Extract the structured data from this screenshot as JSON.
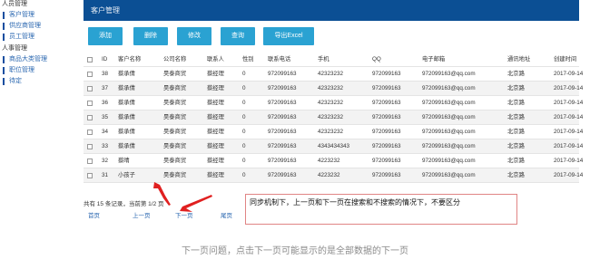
{
  "sidebar": {
    "groups": [
      {
        "label": "人员管理",
        "items": [
          "客户管理",
          "供应商管理",
          "员工管理"
        ]
      },
      {
        "label": "人事管理",
        "items": [
          "商品大类管理",
          "职位管理",
          "待定"
        ]
      }
    ]
  },
  "header": {
    "title": "客户管理"
  },
  "toolbar": {
    "buttons": [
      "添加",
      "删除",
      "修改",
      "查询",
      "导出Excel"
    ]
  },
  "table": {
    "columns": [
      "",
      "ID",
      "客户名称",
      "公司名称",
      "联系人",
      "性别",
      "联系电话",
      "手机",
      "QQ",
      "电子邮箱",
      "通讯地址",
      "创建时间"
    ],
    "rows": [
      [
        "",
        "38",
        "蔡承倩",
        "昊泰商贸",
        "蔡经理",
        "0",
        "972099163",
        "42323232",
        "972099163",
        "972099163@qq.com",
        "北京路",
        "2017-09-14"
      ],
      [
        "",
        "37",
        "蔡承倩",
        "昊泰商贸",
        "蔡经理",
        "0",
        "972099163",
        "42323232",
        "972099163",
        "972099163@qq.com",
        "北京路",
        "2017-09-14"
      ],
      [
        "",
        "36",
        "蔡承倩",
        "昊泰商贸",
        "蔡经理",
        "0",
        "972099163",
        "42323232",
        "972099163",
        "972099163@qq.com",
        "北京路",
        "2017-09-14"
      ],
      [
        "",
        "35",
        "蔡承倩",
        "昊泰商贸",
        "蔡经理",
        "0",
        "972099163",
        "42323232",
        "972099163",
        "972099163@qq.com",
        "北京路",
        "2017-09-14"
      ],
      [
        "",
        "34",
        "蔡承倩",
        "昊泰商贸",
        "蔡经理",
        "0",
        "972099163",
        "42323232",
        "972099163",
        "972099163@qq.com",
        "北京路",
        "2017-09-14"
      ],
      [
        "",
        "33",
        "蔡承倩",
        "昊泰商贸",
        "蔡经理",
        "0",
        "972099163",
        "4343434343",
        "972099163",
        "972099163@qq.com",
        "北京路",
        "2017-09-14"
      ],
      [
        "",
        "32",
        "蔡晴",
        "昊泰商贸",
        "蔡经理",
        "0",
        "972099163",
        "4223232",
        "972099163",
        "972099163@qq.com",
        "北京路",
        "2017-09-14"
      ],
      [
        "",
        "31",
        "小孩子",
        "昊泰商贸",
        "蔡经理",
        "0",
        "972099163",
        "4223232",
        "972099163",
        "972099163@qq.com",
        "北京路",
        "2017-09-14"
      ]
    ]
  },
  "pager": {
    "info": "共有 15 条记录，当前第 1/2 页",
    "links": [
      "首页",
      "上一页",
      "下一页",
      "尾页"
    ]
  },
  "annotation": {
    "note": "同步机制下，上一页和下一页在搜索和不搜索的情况下，不要区分",
    "caption": "下一页问题，点击下一页可能显示的是全部数据的下一页",
    "arrow_color": "#e02020"
  }
}
